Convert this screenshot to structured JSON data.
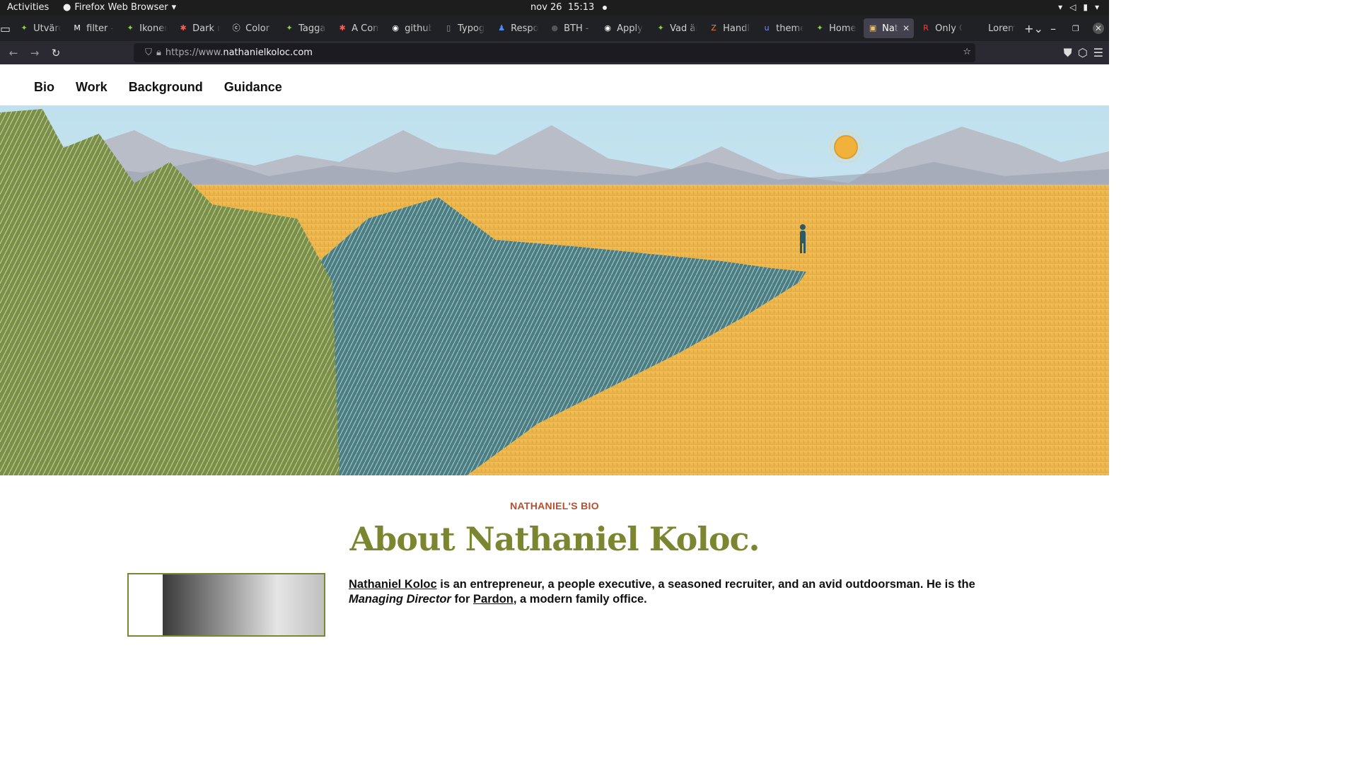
{
  "system_bar": {
    "activities": "Activities",
    "app_name": "Firefox Web Browser",
    "date": "nov 26",
    "time": "15:13"
  },
  "tabs": [
    {
      "label": "Utvärd",
      "icon": "green-star"
    },
    {
      "label": "filter -",
      "icon": "medium-m"
    },
    {
      "label": "Ikoner",
      "icon": "green-star"
    },
    {
      "label": "Dark m",
      "icon": "red-asterisk"
    },
    {
      "label": "Color v",
      "icon": "color-c"
    },
    {
      "label": "Taggar",
      "icon": "green-star"
    },
    {
      "label": "A Com",
      "icon": "red-asterisk"
    },
    {
      "label": "github",
      "icon": "github"
    },
    {
      "label": "Typog",
      "icon": "dark-page"
    },
    {
      "label": "Respo",
      "icon": "blue-person"
    },
    {
      "label": "BTH - C",
      "icon": "dark-circle"
    },
    {
      "label": "Apply",
      "icon": "github"
    },
    {
      "label": "Vad är",
      "icon": "green-star"
    },
    {
      "label": "Handle",
      "icon": "colorful-z"
    },
    {
      "label": "theme",
      "icon": "blue-u"
    },
    {
      "label": "Home",
      "icon": "green-star"
    },
    {
      "label": "Nath",
      "icon": "site-favicon",
      "active": true
    },
    {
      "label": "Only C",
      "icon": "red-r"
    },
    {
      "label": "Lorem",
      "icon": "blank"
    }
  ],
  "address_bar": {
    "url_prefix": "https://www.",
    "url_host": "nathanielkoloc.com"
  },
  "site": {
    "nav": [
      "Bio",
      "Work",
      "Background",
      "Guidance"
    ],
    "eyebrow": "NATHANIEL'S BIO",
    "headline": "About Nathaniel Koloc.",
    "bio": {
      "name_link": "Nathaniel Koloc",
      "text1": " is an entrepreneur, a people executive, a seasoned recruiter, and an avid outdoorsman. He is the ",
      "role": "Managing Director",
      "text2": " for ",
      "company_link": "Pardon",
      "text3": ", a modern family office."
    }
  },
  "colors": {
    "accent_olive": "#7c8630",
    "eyebrow_rust": "#b5502f",
    "field_gold": "#e8b44c",
    "sky": "#cfe6f0"
  }
}
